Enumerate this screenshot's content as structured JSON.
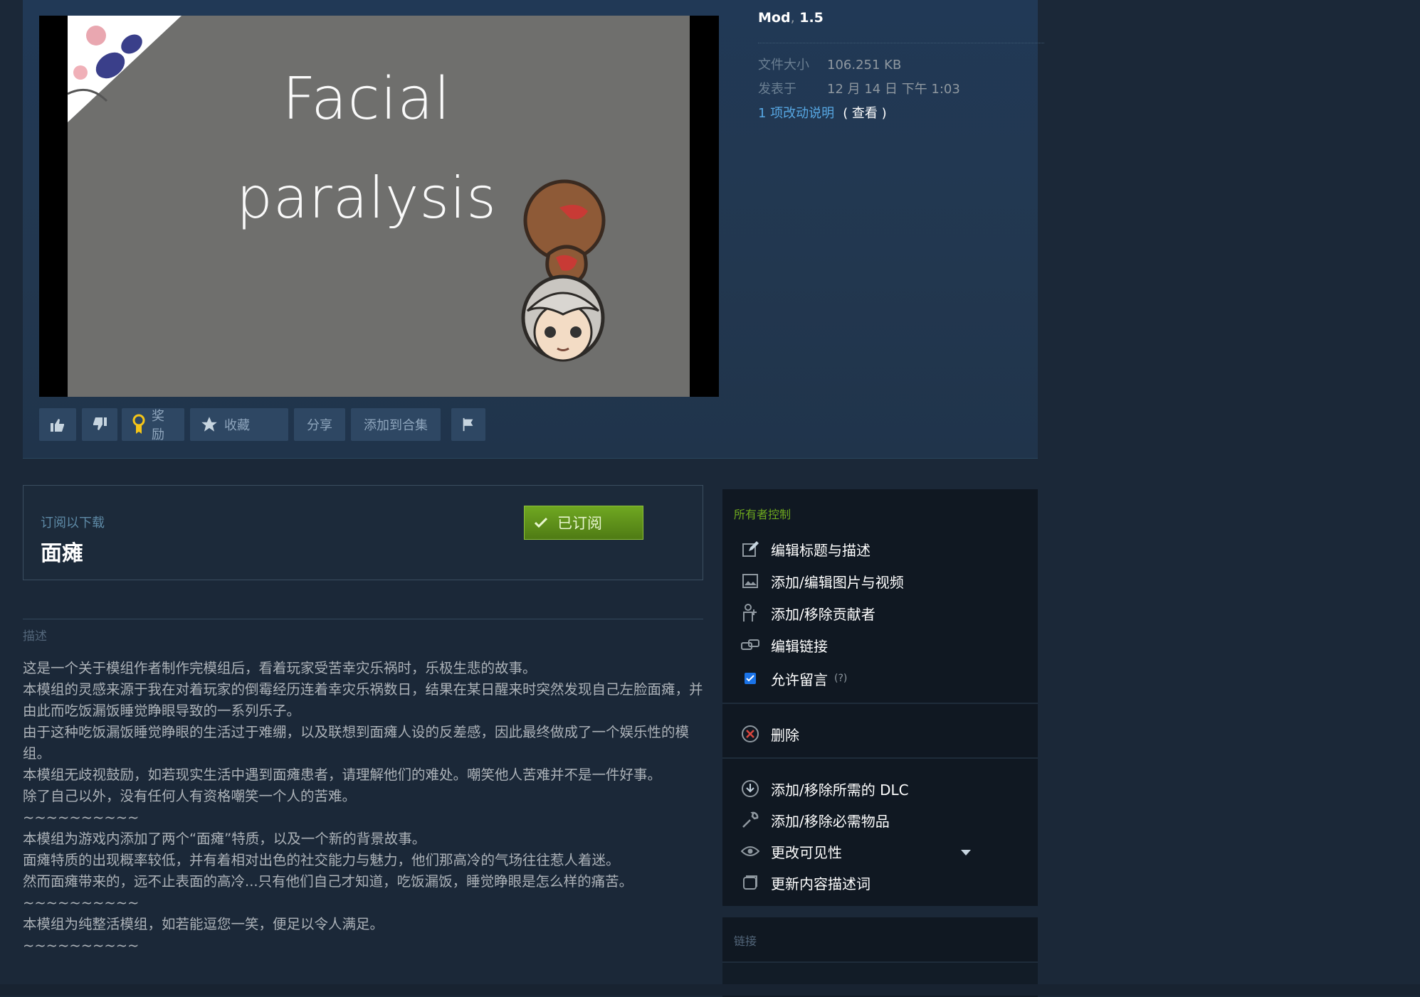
{
  "preview": {
    "title_line1": "Facial",
    "title_line2": "paralysis"
  },
  "actions": {
    "award": "奖励",
    "favorite": "收藏",
    "share": "分享",
    "add_to_collection": "添加到合集"
  },
  "meta": {
    "tag1": "Mod",
    "tag_sep": ",",
    "tag2": "1.5",
    "file_size_label": "文件大小",
    "file_size_value": "106.251 KB",
    "posted_label": "发表于",
    "posted_value": "12 月 14 日 下午 1:03",
    "changes_link": "1 项改动说明",
    "view_link": "( 查看 )"
  },
  "subscribe": {
    "label": "订阅以下载",
    "item_name": "面瘫",
    "button_label": "已订阅"
  },
  "description": {
    "heading": "描述",
    "lines": [
      "这是一个关于模组作者制作完模组后，看着玩家受苦幸灾乐祸时，乐极生悲的故事。",
      "本模组的灵感来源于我在对着玩家的倒霉经历连着幸灾乐祸数日，结果在某日醒来时突然发现自己左脸面瘫，并由此而吃饭漏饭睡觉睁眼导致的一系列乐子。",
      "由于这种吃饭漏饭睡觉睁眼的生活过于难绷，以及联想到面瘫人设的反差感，因此最终做成了一个娱乐性的模组。",
      "本模组无歧视鼓励，如若现实生活中遇到面瘫患者，请理解他们的难处。嘲笑他人苦难并不是一件好事。",
      "除了自己以外，没有任何人有资格嘲笑一个人的苦难。",
      "~~~~~~~~~~",
      "本模组为游戏内添加了两个“面瘫”特质，以及一个新的背景故事。",
      "面瘫特质的出现概率较低，并有着相对出色的社交能力与魅力，他们那高冷的气场往往惹人着迷。",
      "然而面瘫带来的，远不止表面的高冷...只有他们自己才知道，吃饭漏饭，睡觉睁眼是怎么样的痛苦。",
      "~~~~~~~~~~",
      "本模组为纯整活模组，如若能逗您一笑，便足以令人满足。",
      "~~~~~~~~~~"
    ]
  },
  "owner_controls": {
    "heading": "所有者控制",
    "edit_title": "编辑标题与描述",
    "edit_images": "添加/编辑图片与视频",
    "contributors": "添加/移除贡献者",
    "edit_links": "编辑链接",
    "allow_comments": "允许留言",
    "help_mark": "(?)",
    "delete": "删除",
    "required_dlc": "添加/移除所需的 DLC",
    "required_items": "添加/移除必需物品",
    "visibility": "更改可见性",
    "content_descriptors": "更新内容描述词"
  },
  "links_section": {
    "heading": "链接"
  },
  "colors": {
    "background": "#1b2838",
    "subscribed_green": "#5c8c1a",
    "link_blue": "#57a7e3",
    "owner_heading_green": "#6ea91e"
  }
}
